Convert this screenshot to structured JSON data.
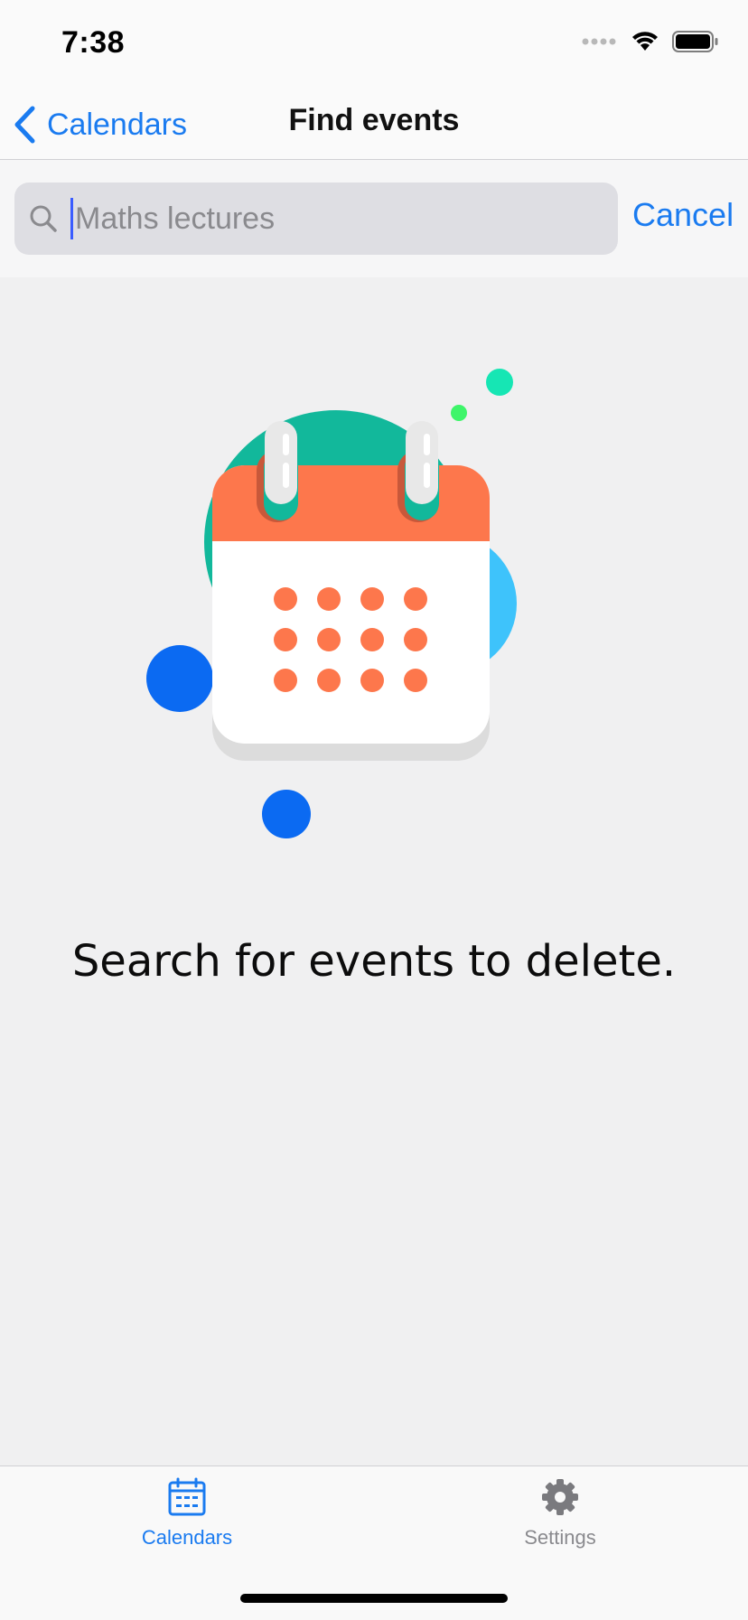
{
  "status_bar": {
    "time": "7:38"
  },
  "nav": {
    "back_label": "Calendars",
    "title": "Find events"
  },
  "search": {
    "placeholder": "Maths lectures",
    "value": "",
    "cancel_label": "Cancel"
  },
  "empty_state": {
    "message": "Search for events to delete."
  },
  "tab_bar": {
    "tabs": [
      {
        "label": "Calendars",
        "icon": "calendar-icon",
        "active": true
      },
      {
        "label": "Settings",
        "icon": "gear-icon",
        "active": false
      }
    ]
  },
  "colors": {
    "accent": "#1a7bf0",
    "calendar_header": "#fd774c",
    "teal_blob": "#12b89b",
    "cyan_blob": "#3ec3fb",
    "blue_dot": "#0b6af2",
    "green_dot": "#3ef56a",
    "mint_dot": "#16e6b4"
  }
}
